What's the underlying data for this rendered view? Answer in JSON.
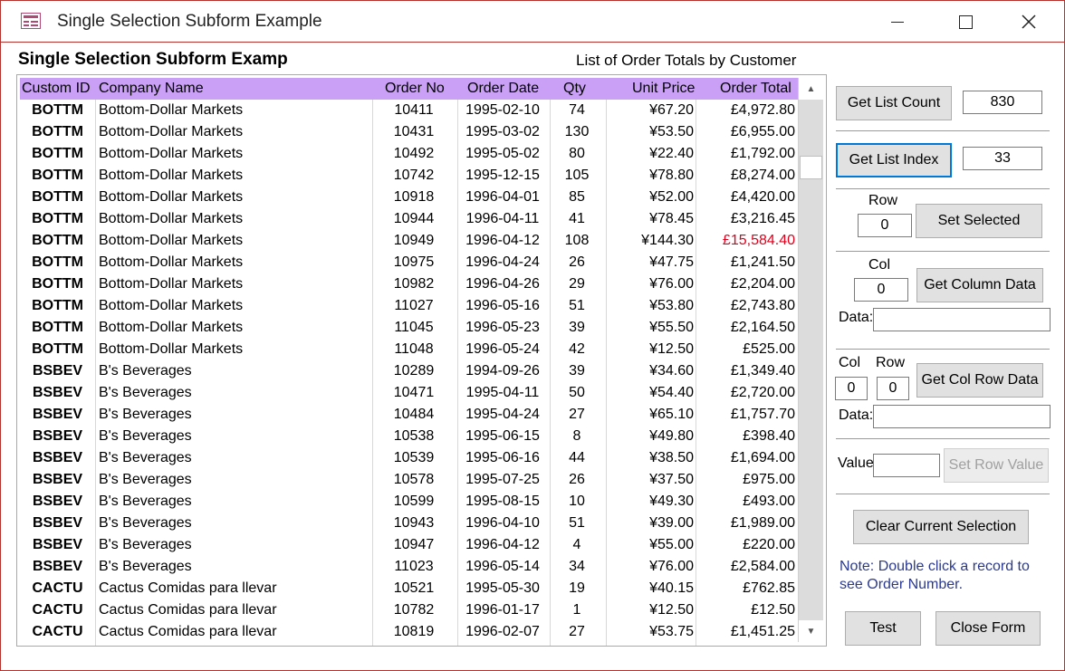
{
  "window": {
    "title": "Single Selection Subform Example",
    "icon": "form-icon"
  },
  "form": {
    "title": "Single Selection Subform Examp",
    "list_caption": "List of Order Totals by Customer"
  },
  "list": {
    "columns": [
      "Custom ID",
      "Company Name",
      "Order No",
      "Order Date",
      "Qty",
      "Unit Price",
      "Order Total"
    ],
    "rows": [
      [
        "BOTTM",
        "Bottom-Dollar Markets",
        "10411",
        "1995-02-10",
        "74",
        "¥67.20",
        "£4,972.80"
      ],
      [
        "BOTTM",
        "Bottom-Dollar Markets",
        "10431",
        "1995-03-02",
        "130",
        "¥53.50",
        "£6,955.00"
      ],
      [
        "BOTTM",
        "Bottom-Dollar Markets",
        "10492",
        "1995-05-02",
        "80",
        "¥22.40",
        "£1,792.00"
      ],
      [
        "BOTTM",
        "Bottom-Dollar Markets",
        "10742",
        "1995-12-15",
        "105",
        "¥78.80",
        "£8,274.00"
      ],
      [
        "BOTTM",
        "Bottom-Dollar Markets",
        "10918",
        "1996-04-01",
        "85",
        "¥52.00",
        "£4,420.00"
      ],
      [
        "BOTTM",
        "Bottom-Dollar Markets",
        "10944",
        "1996-04-11",
        "41",
        "¥78.45",
        "£3,216.45"
      ],
      [
        "BOTTM",
        "Bottom-Dollar Markets",
        "10949",
        "1996-04-12",
        "108",
        "¥144.30",
        "£15,584.40"
      ],
      [
        "BOTTM",
        "Bottom-Dollar Markets",
        "10975",
        "1996-04-24",
        "26",
        "¥47.75",
        "£1,241.50"
      ],
      [
        "BOTTM",
        "Bottom-Dollar Markets",
        "10982",
        "1996-04-26",
        "29",
        "¥76.00",
        "£2,204.00"
      ],
      [
        "BOTTM",
        "Bottom-Dollar Markets",
        "11027",
        "1996-05-16",
        "51",
        "¥53.80",
        "£2,743.80"
      ],
      [
        "BOTTM",
        "Bottom-Dollar Markets",
        "11045",
        "1996-05-23",
        "39",
        "¥55.50",
        "£2,164.50"
      ],
      [
        "BOTTM",
        "Bottom-Dollar Markets",
        "11048",
        "1996-05-24",
        "42",
        "¥12.50",
        "£525.00"
      ],
      [
        "BSBEV",
        "B's Beverages",
        "10289",
        "1994-09-26",
        "39",
        "¥34.60",
        "£1,349.40"
      ],
      [
        "BSBEV",
        "B's Beverages",
        "10471",
        "1995-04-11",
        "50",
        "¥54.40",
        "£2,720.00"
      ],
      [
        "BSBEV",
        "B's Beverages",
        "10484",
        "1995-04-24",
        "27",
        "¥65.10",
        "£1,757.70"
      ],
      [
        "BSBEV",
        "B's Beverages",
        "10538",
        "1995-06-15",
        "8",
        "¥49.80",
        "£398.40"
      ],
      [
        "BSBEV",
        "B's Beverages",
        "10539",
        "1995-06-16",
        "44",
        "¥38.50",
        "£1,694.00"
      ],
      [
        "BSBEV",
        "B's Beverages",
        "10578",
        "1995-07-25",
        "26",
        "¥37.50",
        "£975.00"
      ],
      [
        "BSBEV",
        "B's Beverages",
        "10599",
        "1995-08-15",
        "10",
        "¥49.30",
        "£493.00"
      ],
      [
        "BSBEV",
        "B's Beverages",
        "10943",
        "1996-04-10",
        "51",
        "¥39.00",
        "£1,989.00"
      ],
      [
        "BSBEV",
        "B's Beverages",
        "10947",
        "1996-04-12",
        "4",
        "¥55.00",
        "£220.00"
      ],
      [
        "BSBEV",
        "B's Beverages",
        "11023",
        "1996-05-14",
        "34",
        "¥76.00",
        "£2,584.00"
      ],
      [
        "CACTU",
        "Cactus Comidas para llevar",
        "10521",
        "1995-05-30",
        "19",
        "¥40.15",
        "£762.85"
      ],
      [
        "CACTU",
        "Cactus Comidas para llevar",
        "10782",
        "1996-01-17",
        "1",
        "¥12.50",
        "£12.50"
      ],
      [
        "CACTU",
        "Cactus Comidas para llevar",
        "10819",
        "1996-02-07",
        "27",
        "¥53.75",
        "£1,451.25"
      ]
    ],
    "highlight_color": "#e0001b",
    "highlighted_row": 6
  },
  "controls": {
    "get_list_count_label": "Get List Count",
    "list_count_value": "830",
    "get_list_index_label": "Get List Index",
    "list_index_value": "33",
    "row_label": "Row",
    "row_value": "0",
    "set_selected_label": "Set Selected",
    "col_label": "Col",
    "col_value": "0",
    "get_column_data_label": "Get Column Data",
    "data_label": "Data:",
    "column_data_value": "",
    "col2_label": "Col",
    "row2_label": "Row",
    "col2_value": "0",
    "row2_value": "0",
    "get_col_row_data_label": "Get Col Row Data",
    "data2_label": "Data:",
    "col_row_data_value": "",
    "value_label": "Value",
    "value_field": "",
    "set_row_value_label": "Set Row Value",
    "clear_selection_label": "Clear Current Selection",
    "note": "Note: Double click a record to see Order Number.",
    "test_label": "Test",
    "close_form_label": "Close Form"
  }
}
